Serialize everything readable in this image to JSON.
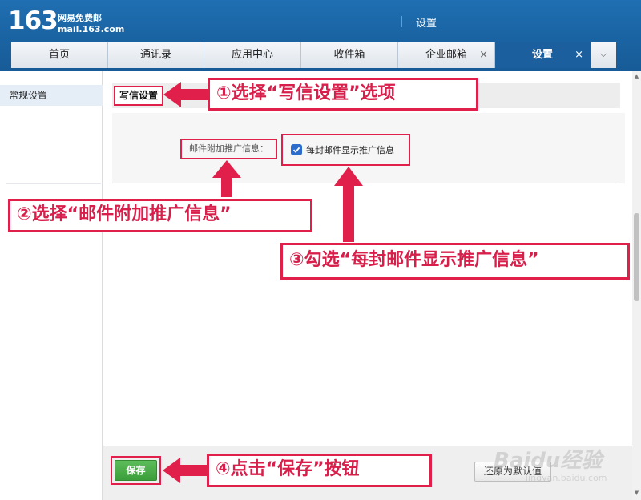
{
  "header": {
    "logo_number": "163",
    "logo_line1": "网易免费邮",
    "logo_line2": "mail.163.com",
    "title": "设置"
  },
  "tabs": [
    {
      "label": "首页",
      "closable": false,
      "active": false
    },
    {
      "label": "通讯录",
      "closable": false,
      "active": false
    },
    {
      "label": "应用中心",
      "closable": false,
      "active": false
    },
    {
      "label": "收件箱",
      "closable": false,
      "active": false
    },
    {
      "label": "企业邮箱",
      "closable": true,
      "active": false
    },
    {
      "label": "设置",
      "closable": true,
      "active": true
    }
  ],
  "tab_close_glyph": "×",
  "tab_more_glyph": "⌵",
  "sidebar": {
    "items": [
      {
        "label": "常规设置",
        "selected": true
      }
    ]
  },
  "section": {
    "tab_label": "写信设置"
  },
  "form": {
    "field_label": "邮件附加推广信息：",
    "checkbox": {
      "label": "每封邮件显示推广信息",
      "checked": true
    }
  },
  "footer": {
    "save_label": "保存",
    "restore_label": "还原为默认值"
  },
  "callouts": {
    "step1": "①选择“写信设置”选项",
    "step2": "②选择“邮件附加推广信息”",
    "step3": "③勾选“每封邮件显示推广信息”",
    "step4": "④点击“保存”按钮"
  },
  "watermark": {
    "text": "Baidu经验",
    "sub": "jingyan.baidu.com"
  },
  "colors": {
    "header_blue": "#1a63a2",
    "active_tab": "#1b5f9e",
    "annotation_red": "#e0204b",
    "save_green": "#4aab48",
    "checkbox_blue": "#2d6ccb"
  }
}
